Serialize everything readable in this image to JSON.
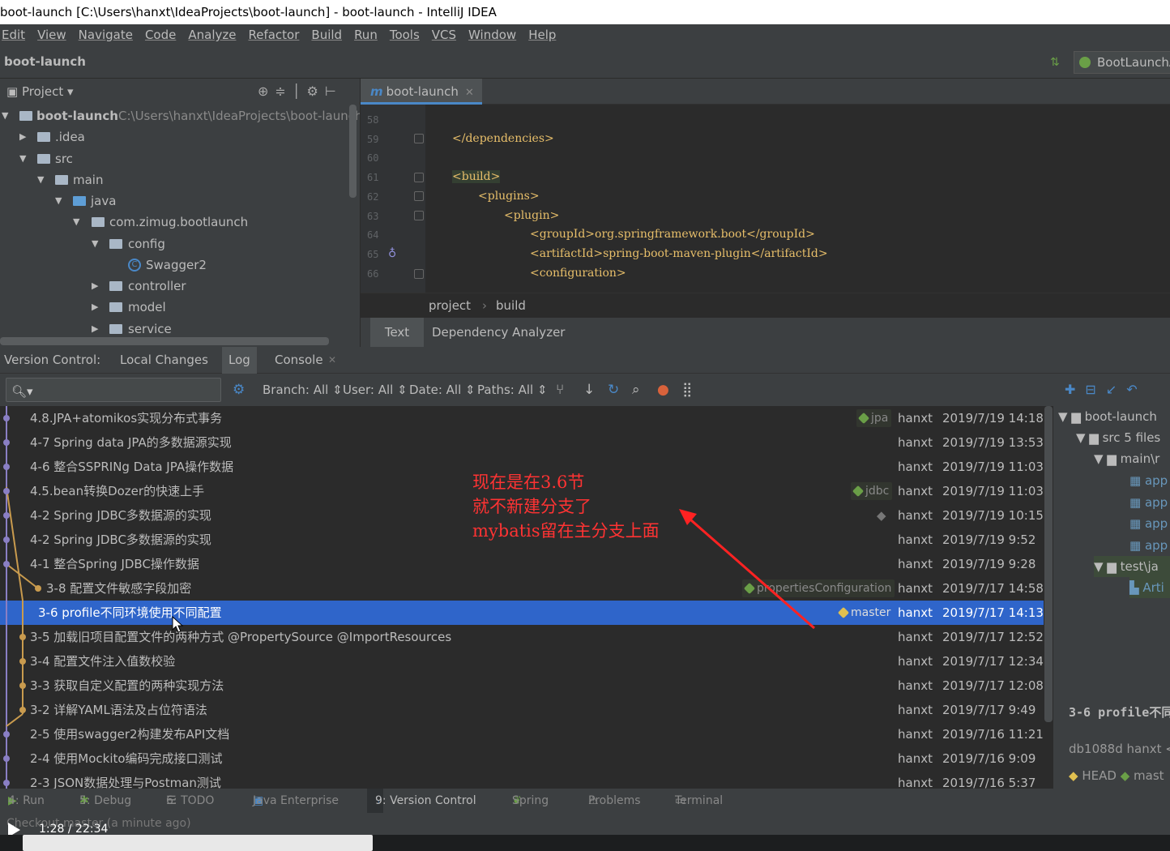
{
  "window_title": "boot-launch [C:\\Users\\hanxt\\IdeaProjects\\boot-launch] - boot-launch - IntelliJ IDEA",
  "menu": [
    "Edit",
    "View",
    "Navigate",
    "Code",
    "Analyze",
    "Refactor",
    "Build",
    "Run",
    "Tools",
    "VCS",
    "Window",
    "Help"
  ],
  "nav": {
    "project_crumb": "boot-launch",
    "run_config": "BootLaunchA"
  },
  "project_panel": {
    "title": "Project",
    "tree": [
      {
        "label": "boot-launch",
        "path": "C:\\Users\\hanxt\\IdeaProjects\\boot-launch"
      },
      {
        "label": ".idea"
      },
      {
        "label": "src"
      },
      {
        "label": "main"
      },
      {
        "label": "java"
      },
      {
        "label": "com.zimug.bootlaunch"
      },
      {
        "label": "config"
      },
      {
        "label": "Swagger2"
      },
      {
        "label": "controller"
      },
      {
        "label": "model"
      },
      {
        "label": "service"
      }
    ]
  },
  "editor": {
    "tab": "boot-launch",
    "lines": [
      {
        "n": "58",
        "code": ""
      },
      {
        "n": "59",
        "code": "</dependencies>"
      },
      {
        "n": "60",
        "code": ""
      },
      {
        "n": "61",
        "code": "<build>"
      },
      {
        "n": "62",
        "code": "<plugins>"
      },
      {
        "n": "63",
        "code": "<plugin>"
      },
      {
        "n": "64",
        "code": "<groupId>org.springframework.boot</groupId>"
      },
      {
        "n": "65",
        "code": "<artifactId>spring-boot-maven-plugin</artifactId>"
      },
      {
        "n": "66",
        "code": "<configuration>"
      }
    ],
    "breadcrumb": [
      "project",
      "build"
    ],
    "bottom_tabs": [
      "Text",
      "Dependency Analyzer"
    ]
  },
  "version_control": {
    "label": "Version Control:",
    "tabs": [
      "Local Changes",
      "Log",
      "Console"
    ],
    "filters": {
      "branch": "Branch: All",
      "user": "User: All",
      "date": "Date: All",
      "paths": "Paths: All"
    },
    "commits": [
      {
        "msg": "4.8.JPA+atomikos实现分布式事务",
        "ref": "jpa",
        "user": "hanxt",
        "date": "2019/7/19 14:18"
      },
      {
        "msg": "4-7 Spring data JPA的多数据源实现",
        "ref": "",
        "user": "hanxt",
        "date": "2019/7/19 13:53"
      },
      {
        "msg": "4-6 整合SSPRINg Data JPA操作数据",
        "ref": "",
        "user": "hanxt",
        "date": "2019/7/19 11:03"
      },
      {
        "msg": "4.5.bean转换Dozer的快速上手",
        "ref": "jdbc",
        "user": "hanxt",
        "date": "2019/7/19 11:03"
      },
      {
        "msg": "4-2 Spring JDBC多数据源的实现",
        "ref": "",
        "user": "hanxt",
        "date": "2019/7/19 10:15"
      },
      {
        "msg": "4-2 Spring JDBC多数据源的实现",
        "ref": "",
        "user": "hanxt",
        "date": "2019/7/19 9:52"
      },
      {
        "msg": "4-1 整合Spring JDBC操作数据",
        "ref": "",
        "user": "hanxt",
        "date": "2019/7/19 9:28"
      },
      {
        "msg": "3-8 配置文件敏感字段加密",
        "ref": "propertiesConfiguration",
        "user": "hanxt",
        "date": "2019/7/17 14:58"
      },
      {
        "msg": "3-6 profile不同环境使用不同配置",
        "ref": "master",
        "user": "hanxt",
        "date": "2019/7/17 14:13"
      },
      {
        "msg": "3-5 加载旧项目配置文件的两种方式 @PropertySource @ImportResources",
        "ref": "",
        "user": "hanxt",
        "date": "2019/7/17 12:52"
      },
      {
        "msg": "3-4 配置文件注入值数校验",
        "ref": "",
        "user": "hanxt",
        "date": "2019/7/17 12:34"
      },
      {
        "msg": "3-3 获取自定义配置的两种实现方法",
        "ref": "",
        "user": "hanxt",
        "date": "2019/7/17 12:08"
      },
      {
        "msg": "3-2 详解YAML语法及占位符语法",
        "ref": "",
        "user": "hanxt",
        "date": "2019/7/17 9:49"
      },
      {
        "msg": "2-5 使用swagger2构建发布API文档",
        "ref": "",
        "user": "hanxt",
        "date": "2019/7/16 11:21"
      },
      {
        "msg": "2-4 使用Mockito编码完成接口测试",
        "ref": "",
        "user": "hanxt",
        "date": "2019/7/16 9:09"
      },
      {
        "msg": "2-3 JSON数据处理与Postman测试",
        "ref": "",
        "user": "hanxt",
        "date": "2019/7/16 5:37"
      }
    ],
    "changes_tree": [
      "boot-launch",
      "src 5 files",
      "main\\r",
      "app",
      "app",
      "app",
      "app",
      "test\\ja",
      "Arti"
    ],
    "detail": {
      "subject": "3-6 profile不同",
      "hash_user": "db1088d hanxt <",
      "refs": [
        "HEAD",
        "mast"
      ]
    }
  },
  "annotation": [
    "现在是在3.6节",
    "就不新建分支了",
    "mybatis留在主分支上面"
  ],
  "tool_windows": [
    "4: Run",
    "5: Debug",
    "6: TODO",
    "Java Enterprise",
    "9: Version Control",
    "Spring",
    "Problems",
    "Terminal"
  ],
  "status": "Checkout master (a minute ago)",
  "player": {
    "time": "1:28 / 22:34"
  },
  "colors": {
    "accent": "#2f65ca",
    "annotation": "#ff3333",
    "branch_tag": "#6a9f47"
  }
}
